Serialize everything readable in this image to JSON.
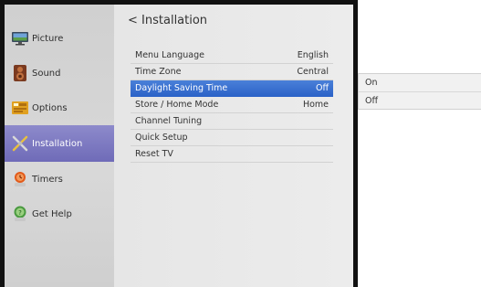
{
  "sidebar": {
    "items": [
      {
        "label": "Picture",
        "icon": "picture-icon"
      },
      {
        "label": "Sound",
        "icon": "sound-icon"
      },
      {
        "label": "Options",
        "icon": "options-icon"
      },
      {
        "label": "Installation",
        "icon": "installation-icon",
        "active": true
      },
      {
        "label": "Timers",
        "icon": "timer-icon"
      },
      {
        "label": "Get Help",
        "icon": "help-icon"
      }
    ]
  },
  "main": {
    "title": "Installation",
    "back_glyph": "<",
    "menu": [
      {
        "label": "Menu Language",
        "value": "English"
      },
      {
        "label": "Time Zone",
        "value": "Central"
      },
      {
        "label": "Daylight Saving Time",
        "value": "Off",
        "selected": true
      },
      {
        "label": "Store / Home Mode",
        "value": "Home"
      },
      {
        "label": "Channel Tuning",
        "value": ""
      },
      {
        "label": "Quick Setup",
        "value": ""
      },
      {
        "label": "Reset TV",
        "value": ""
      }
    ]
  },
  "popup": {
    "options": [
      "On",
      "Off"
    ]
  },
  "colors": {
    "active_sidebar": "#7a76c0",
    "selected_row": "#3a72d2",
    "frame": "#111111"
  }
}
